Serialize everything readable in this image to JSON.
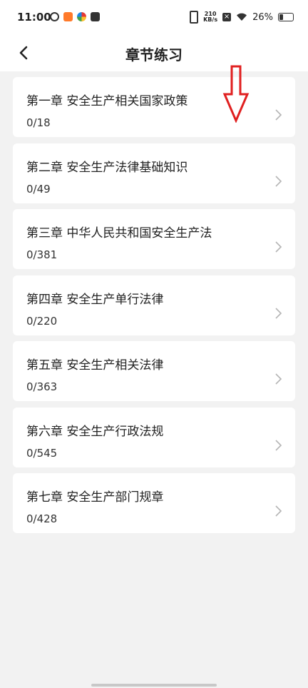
{
  "status_bar": {
    "time": "11:00",
    "net_speed_value": "210",
    "net_speed_unit": "KB/s",
    "battery": "26%"
  },
  "header": {
    "title": "章节练习",
    "back_icon": "chevron-left-icon"
  },
  "chapters": [
    {
      "title": "第一章  安全生产相关国家政策",
      "progress": "0/18"
    },
    {
      "title": "第二章  安全生产法律基础知识",
      "progress": "0/49"
    },
    {
      "title": "第三章  中华人民共和国安全生产法",
      "progress": "0/381"
    },
    {
      "title": "第四章  安全生产单行法律",
      "progress": "0/220"
    },
    {
      "title": "第五章 安全生产相关法律",
      "progress": "0/363"
    },
    {
      "title": "第六章 安全生产行政法规",
      "progress": "0/545"
    },
    {
      "title": "第七章 安全生产部门规章",
      "progress": "0/428"
    }
  ],
  "colors": {
    "background": "#f2f2f2",
    "card": "#ffffff",
    "annotation_arrow": "#e02020"
  }
}
